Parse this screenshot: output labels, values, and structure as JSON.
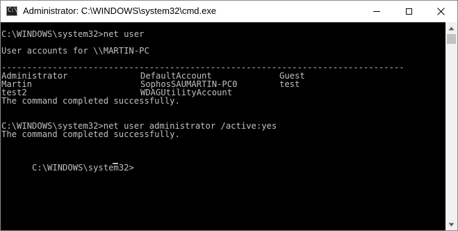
{
  "window": {
    "title": "Administrator: C:\\WINDOWS\\system32\\cmd.exe",
    "icon": "command-prompt-icon",
    "icon_text": "C:\\"
  },
  "titlebar_buttons": {
    "minimize_icon": "minimize-icon",
    "maximize_icon": "maximize-icon",
    "close_icon": "close-icon"
  },
  "console": {
    "background": "#000000",
    "foreground": "#c0c0c0",
    "line1": "C:\\WINDOWS\\system32>net user",
    "line2": "User accounts for \\\\MARTIN-PC",
    "separator": "-------------------------------------------------------------------------------",
    "accounts": [
      [
        "Administrator",
        "DefaultAccount",
        "Guest"
      ],
      [
        "Martin",
        "SophosSAUMARTIN-PC0",
        "test"
      ],
      [
        "test2",
        "WDAGUtilityAccount",
        ""
      ]
    ],
    "done1": "The command completed successfully.",
    "line_cmd2": "C:\\WINDOWS\\system32>net user administrator /active:yes",
    "done2": "The command completed successfully.",
    "prompt": "C:\\WINDOWS\\system32>"
  },
  "scrollbar": {
    "up_icon": "scroll-up-arrow-icon",
    "down_icon": "scroll-down-arrow-icon"
  }
}
